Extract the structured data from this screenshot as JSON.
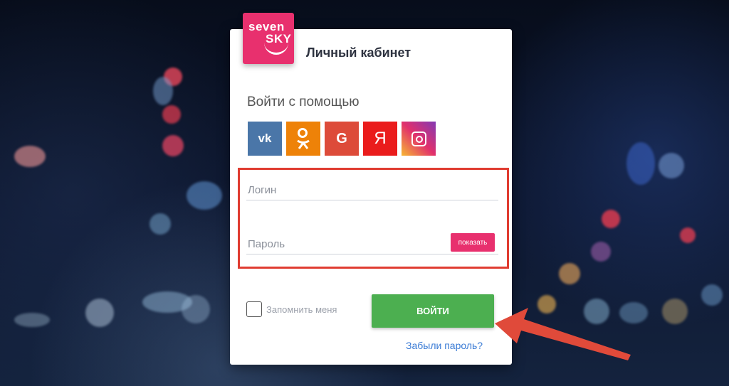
{
  "logo": {
    "line1": "seven",
    "line2": "SKY"
  },
  "header": {
    "title": "Личный кабинет"
  },
  "social": {
    "heading": "Войти с помощью",
    "buttons": [
      {
        "icon": "vk-icon",
        "label": "vk"
      },
      {
        "icon": "odnoklassniki-icon",
        "label": ""
      },
      {
        "icon": "google-icon",
        "label": "G"
      },
      {
        "icon": "yandex-icon",
        "label": "Я"
      },
      {
        "icon": "instagram-icon",
        "label": ""
      }
    ]
  },
  "form": {
    "login_placeholder": "Логин",
    "login_value": "",
    "password_placeholder": "Пароль",
    "password_value": "",
    "show_password_label": "показать",
    "remember_label": "Запомнить меня",
    "remember_checked": false,
    "submit_label": "ВОЙТИ",
    "forgot_label": "Забыли пароль?"
  },
  "colors": {
    "brand": "#e8306e",
    "submit": "#4caf50",
    "highlight": "#e03c31",
    "link": "#3a7bd5"
  }
}
